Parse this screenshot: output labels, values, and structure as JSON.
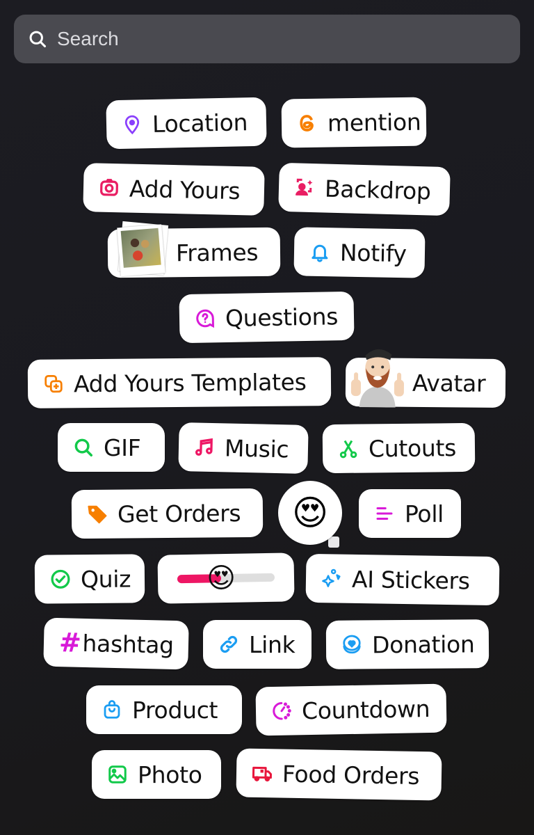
{
  "search": {
    "placeholder": "Search",
    "value": ""
  },
  "stickers": {
    "location": {
      "label": "Location",
      "icon": "location-pin-icon",
      "color": "#8a3ffc"
    },
    "mention": {
      "label": "mention",
      "icon": "threads-at-icon",
      "color": "#f77f00"
    },
    "add_yours": {
      "label": "Add Yours",
      "icon": "camera-icon",
      "color": "#e91e63"
    },
    "backdrop": {
      "label": "Backdrop",
      "icon": "backdrop-person-sparkle-icon",
      "color": "#e91e63"
    },
    "frames": {
      "label": "Frames",
      "icon": "polaroid-photo-icon"
    },
    "notify": {
      "label": "Notify",
      "icon": "bell-icon",
      "color": "#1a9df2"
    },
    "questions": {
      "label": "Questions",
      "icon": "question-bubble-icon",
      "color": "#d81ad8"
    },
    "add_yours_templates": {
      "label": "Add Yours Templates",
      "icon": "add-template-icon",
      "color": "#f77f00"
    },
    "avatar": {
      "label": "Avatar",
      "icon": "avatar-thumbs-up-icon"
    },
    "gif": {
      "label": "GIF",
      "icon": "search-icon",
      "color": "#12c94a"
    },
    "music": {
      "label": "Music",
      "icon": "music-note-icon",
      "color": "#ee1664"
    },
    "cutouts": {
      "label": "Cutouts",
      "icon": "scissors-icon",
      "color": "#12c94a"
    },
    "get_orders": {
      "label": "Get Orders",
      "icon": "price-tag-icon",
      "color": "#f77f00"
    },
    "emoji_reaction": {
      "emoji": "😍",
      "icon": "emoji-reaction-icon"
    },
    "poll": {
      "label": "Poll",
      "icon": "poll-lines-icon",
      "color": "#d81ad8"
    },
    "quiz": {
      "label": "Quiz",
      "icon": "check-circle-icon",
      "color": "#12c94a"
    },
    "emoji_slider": {
      "emoji": "😍",
      "value": 0.45,
      "fill_color": "#ee1664",
      "icon": "emoji-slider-icon"
    },
    "ai_stickers": {
      "label": "AI Stickers",
      "icon": "sparkles-icon",
      "color": "#1a9df2"
    },
    "hashtag": {
      "label": "hashtag",
      "icon": "hash-icon",
      "color": "#d81ad8",
      "symbol": "#"
    },
    "link": {
      "label": "Link",
      "icon": "link-icon",
      "color": "#1a9df2"
    },
    "donation": {
      "label": "Donation",
      "icon": "donation-heart-coin-icon",
      "color": "#1a9df2"
    },
    "product": {
      "label": "Product",
      "icon": "shopping-bag-icon",
      "color": "#1a9df2"
    },
    "countdown": {
      "label": "Countdown",
      "icon": "timer-icon",
      "color": "#d81ad8"
    },
    "photo": {
      "label": "Photo",
      "icon": "image-icon",
      "color": "#12c94a"
    },
    "food_orders": {
      "label": "Food Orders",
      "icon": "delivery-truck-icon",
      "color": "#e8163c"
    }
  }
}
